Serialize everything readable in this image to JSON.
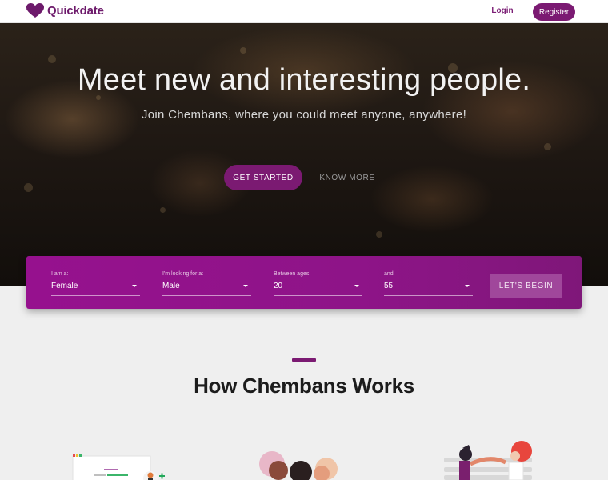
{
  "header": {
    "brand": "Quickdate",
    "login_label": "Login",
    "register_label": "Register"
  },
  "hero": {
    "title": "Meet new and interesting people.",
    "subtitle": "Join Chembans, where you could meet anyone, anywhere!",
    "get_started_label": "GET STARTED",
    "know_more_label": "KNOW MORE"
  },
  "search": {
    "fields": [
      {
        "label": "I am a:",
        "value": "Female"
      },
      {
        "label": "I'm looking for a:",
        "value": "Male"
      },
      {
        "label": "Between ages:",
        "value": "20"
      },
      {
        "label": "and",
        "value": "55"
      }
    ],
    "submit_label": "LET'S BEGIN"
  },
  "section": {
    "title": "How Chembans Works"
  },
  "colors": {
    "brand": "#7b1a72",
    "panel": "#96118e",
    "accent_green": "#22a85a"
  }
}
